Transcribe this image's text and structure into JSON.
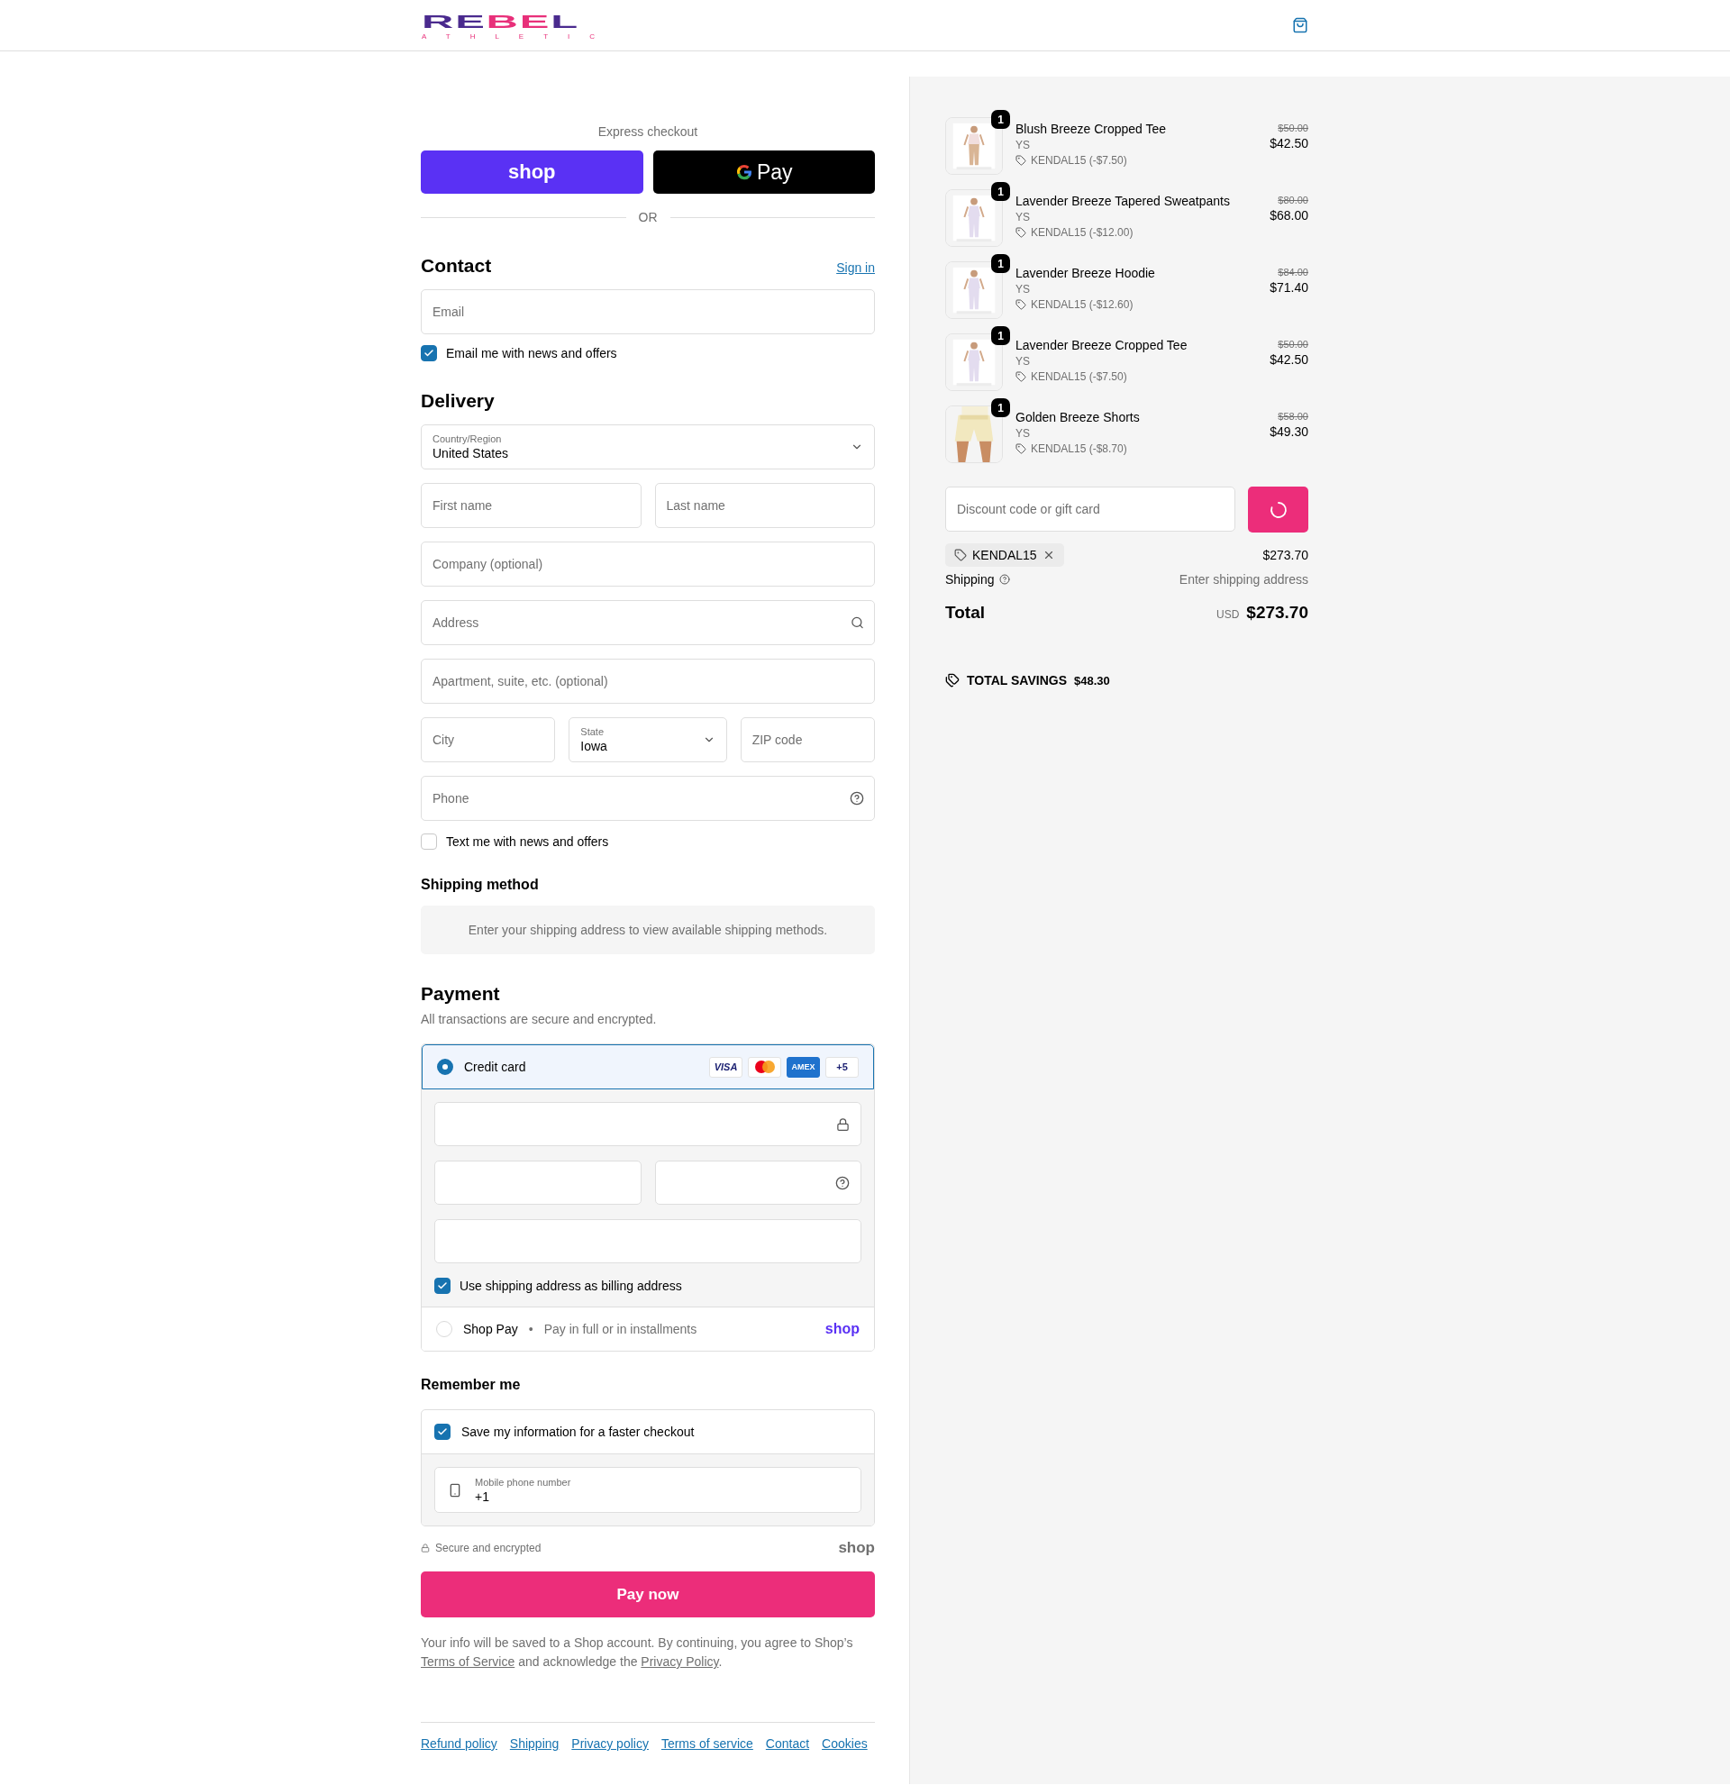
{
  "header": {
    "logo_parts": [
      {
        "text": "RE",
        "color": "#4a2a8e"
      },
      {
        "text": "BE",
        "color": "#e8307a"
      },
      {
        "text": "L",
        "color": "#4a2a8e"
      }
    ],
    "logo_subtitle": "ATHLETIC"
  },
  "express": {
    "label": "Express checkout",
    "buttons": [
      {
        "kind": "shop",
        "label": "shop"
      },
      {
        "kind": "gpay",
        "label": "Pay"
      }
    ],
    "divider": "OR"
  },
  "contact": {
    "title": "Contact",
    "sign_in": "Sign in",
    "email_placeholder": "Email",
    "newsletter": {
      "label": "Email me with news and offers",
      "checked": true
    }
  },
  "delivery": {
    "title": "Delivery",
    "rows": [
      [
        {
          "kind": "select",
          "label": "Country/Region",
          "value": "United States"
        }
      ],
      [
        {
          "kind": "text",
          "placeholder": "First name"
        },
        {
          "kind": "text",
          "placeholder": "Last name"
        }
      ],
      [
        {
          "kind": "text",
          "placeholder": "Company (optional)"
        }
      ],
      [
        {
          "kind": "search",
          "placeholder": "Address"
        }
      ],
      [
        {
          "kind": "text",
          "placeholder": "Apartment, suite, etc. (optional)"
        }
      ],
      [
        {
          "kind": "text",
          "placeholder": "City"
        },
        {
          "kind": "select",
          "label": "State",
          "value": "Iowa"
        },
        {
          "kind": "text",
          "placeholder": "ZIP code"
        }
      ],
      [
        {
          "kind": "help",
          "placeholder": "Phone"
        }
      ]
    ],
    "text_me": {
      "label": "Text me with news and offers",
      "checked": false
    }
  },
  "shipping_method": {
    "title": "Shipping method",
    "message": "Enter your shipping address to view available shipping methods."
  },
  "payment": {
    "title": "Payment",
    "subtitle": "All transactions are secure and encrypted.",
    "methods": [
      {
        "kind": "card",
        "label": "Credit card",
        "selected": true,
        "brands": [
          {
            "kind": "visa",
            "label": "VISA"
          },
          {
            "kind": "mastercard"
          },
          {
            "kind": "amex",
            "label": "AMEX"
          },
          {
            "kind": "more",
            "label": "+5"
          }
        ],
        "billing": {
          "label": "Use shipping address as billing address",
          "checked": true
        }
      },
      {
        "kind": "shop_pay",
        "label": "Shop Pay",
        "separator": "•",
        "note": "Pay in full or in installments",
        "logo": "shop",
        "selected": false
      }
    ]
  },
  "remember": {
    "title": "Remember me",
    "save": {
      "label": "Save my information for a faster checkout",
      "checked": true
    },
    "phone": {
      "label": "Mobile phone number",
      "value": "+1"
    }
  },
  "secure": {
    "label": "Secure and encrypted",
    "logo": "shop"
  },
  "pay_button": "Pay now",
  "legal": [
    {
      "kind": "text",
      "text": "Your info will be saved to a Shop account. By continuing, you agree to Shop’s "
    },
    {
      "kind": "link",
      "text": "Terms of Service"
    },
    {
      "kind": "text",
      "text": " and acknowledge the "
    },
    {
      "kind": "link",
      "text": "Privacy Policy"
    },
    {
      "kind": "text",
      "text": "."
    }
  ],
  "footer_links": [
    "Refund policy",
    "Shipping",
    "Privacy policy",
    "Terms of service",
    "Contact",
    "Cookies"
  ],
  "summary": {
    "items": [
      {
        "name": "Blush Breeze Cropped Tee",
        "variant": "YS",
        "discount": "KENDAL15 (-$7.50)",
        "original_price": "$50.00",
        "price": "$42.50",
        "quantity": "1"
      },
      {
        "name": "Lavender Breeze Tapered Sweatpants",
        "variant": "YS",
        "discount": "KENDAL15 (-$12.00)",
        "original_price": "$80.00",
        "price": "$68.00",
        "quantity": "1"
      },
      {
        "name": "Lavender Breeze Hoodie",
        "variant": "YS",
        "discount": "KENDAL15 (-$12.60)",
        "original_price": "$84.00",
        "price": "$71.40",
        "quantity": "1"
      },
      {
        "name": "Lavender Breeze Cropped Tee",
        "variant": "YS",
        "discount": "KENDAL15 (-$7.50)",
        "original_price": "$50.00",
        "price": "$42.50",
        "quantity": "1"
      },
      {
        "name": "Golden Breeze Shorts",
        "variant": "YS",
        "discount": "KENDAL15 (-$8.70)",
        "original_price": "$58.00",
        "price": "$49.30",
        "quantity": "1"
      }
    ],
    "discount_placeholder": "Discount code or gift card",
    "applied_code": "KENDAL15",
    "subtotal": "$273.70",
    "shipping": {
      "label": "Shipping",
      "value": "Enter shipping address"
    },
    "total": {
      "label": "Total",
      "currency": "USD",
      "amount": "$273.70"
    },
    "savings": {
      "label": "TOTAL SAVINGS",
      "amount": "$48.30"
    }
  }
}
